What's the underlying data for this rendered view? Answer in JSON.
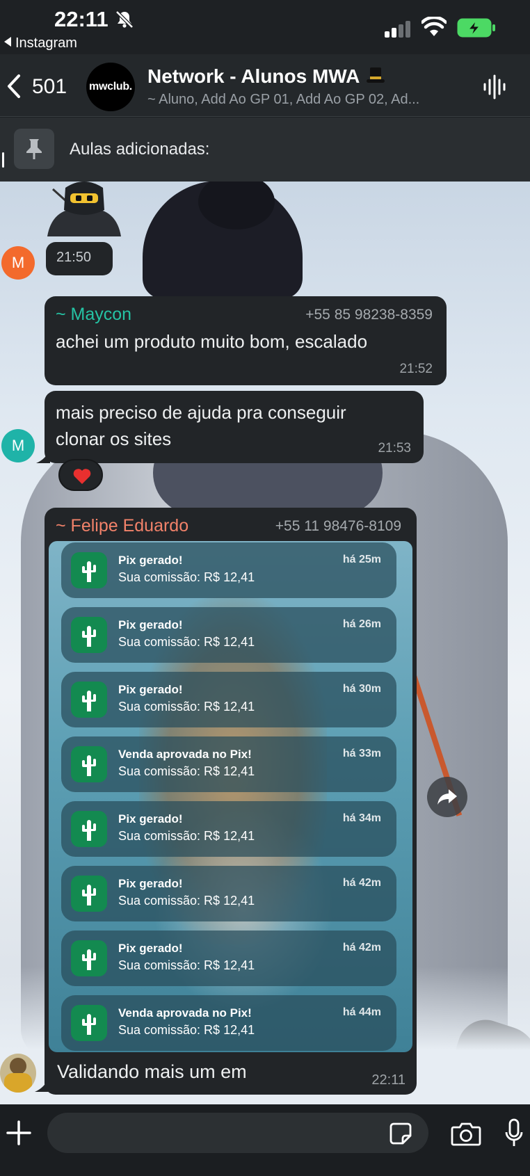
{
  "status_bar": {
    "time": "22:11",
    "back_app": "Instagram",
    "icons": [
      "bell-off-icon",
      "signal-icon",
      "wifi-icon",
      "battery-charging-icon"
    ],
    "battery_color": "#4cd964"
  },
  "header": {
    "unread_count": "501",
    "avatar_text": "mwclub.",
    "group_name": "Network - Alunos MWA",
    "group_emoji": "top-hat-icon",
    "members": "~ Aluno, Add Ao GP 01, Add Ao GP 02, Ad..."
  },
  "pinned": {
    "text": "Aulas adicionadas:"
  },
  "messages": {
    "sticker_time": "21:50",
    "sender1_avatar": "M",
    "m1": {
      "sender": "~ Maycon",
      "sender_color": "#25c3a4",
      "phone": "+55 85 98238-8359",
      "text": "achei um produto muito bom, escalado",
      "time": "21:52"
    },
    "sender2_avatar": "M",
    "m2": {
      "text_line1": "mais preciso de ajuda pra conseguir",
      "text_line2": "clonar os sites",
      "time": "21:53",
      "reaction": "heart"
    },
    "m3": {
      "sender": "~ Felipe Eduardo",
      "sender_color": "#f2826a",
      "phone": "+55 11 98476-8109",
      "caption": "Validando mais um em",
      "time": "22:11",
      "notifications": [
        {
          "title": "Pix gerado!",
          "body": "Sua comissão: R$ 12,41",
          "age": "há 25m"
        },
        {
          "title": "Pix gerado!",
          "body": "Sua comissão: R$ 12,41",
          "age": "há 26m"
        },
        {
          "title": "Pix gerado!",
          "body": "Sua comissão: R$ 12,41",
          "age": "há 30m"
        },
        {
          "title": "Venda aprovada no Pix!",
          "body": "Sua comissão: R$ 12,41",
          "age": "há 33m"
        },
        {
          "title": "Pix gerado!",
          "body": "Sua comissão: R$ 12,41",
          "age": "há 34m"
        },
        {
          "title": "Pix gerado!",
          "body": "Sua comissão: R$ 12,41",
          "age": "há 42m"
        },
        {
          "title": "Pix gerado!",
          "body": "Sua comissão: R$ 12,41",
          "age": "há 42m"
        },
        {
          "title": "Venda aprovada no Pix!",
          "body": "Sua comissão: R$ 12,41",
          "age": "há 44m"
        }
      ]
    }
  },
  "composer": {
    "placeholder": ""
  }
}
